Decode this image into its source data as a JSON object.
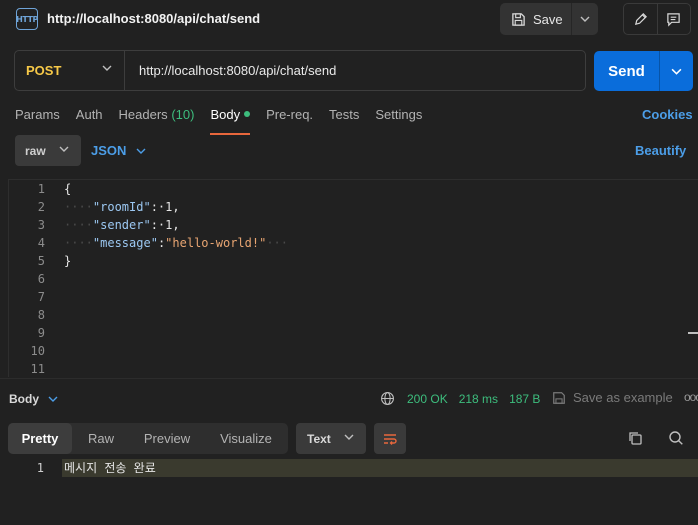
{
  "titlebar": {
    "icon_text": "HTTP",
    "request_title": "http://localhost:8080/api/chat/send",
    "save_label": "Save"
  },
  "request": {
    "method": "POST",
    "url": "http://localhost:8080/api/chat/send",
    "send_label": "Send"
  },
  "tabs": [
    {
      "label": "Params"
    },
    {
      "label": "Auth"
    },
    {
      "label": "Headers",
      "count": "(10)"
    },
    {
      "label": "Body",
      "active": true
    },
    {
      "label": "Pre-req."
    },
    {
      "label": "Tests"
    },
    {
      "label": "Settings"
    }
  ],
  "cookies_label": "Cookies",
  "body_options": {
    "mode": "raw",
    "language": "JSON",
    "beautify_label": "Beautify"
  },
  "editor": {
    "line_numbers": [
      "1",
      "2",
      "3",
      "4",
      "5",
      "6",
      "7",
      "8",
      "9",
      "10",
      "11"
    ],
    "lines": {
      "l1": "{",
      "k2": "\"roomId\"",
      "v2": "1",
      "k3": "\"sender\"",
      "v3": "1",
      "k4": "\"message\"",
      "v4": "\"hello-world!\"",
      "l5": "}"
    }
  },
  "response": {
    "body_label": "Body",
    "status": "200 OK",
    "time": "218 ms",
    "size": "187 B",
    "save_example_label": "Save as example",
    "more": "ooo",
    "tabs": [
      "Pretty",
      "Raw",
      "Preview",
      "Visualize"
    ],
    "active_tab": "Pretty",
    "format": "Text",
    "line_number": "1",
    "content": "메시지 전송 완료"
  },
  "colors": {
    "accent_send": "#0a6ddb",
    "method_post": "#f7c948",
    "status_ok": "#3dbd7d",
    "link": "#4c9ee8",
    "active_tab_underline": "#e8673c"
  }
}
